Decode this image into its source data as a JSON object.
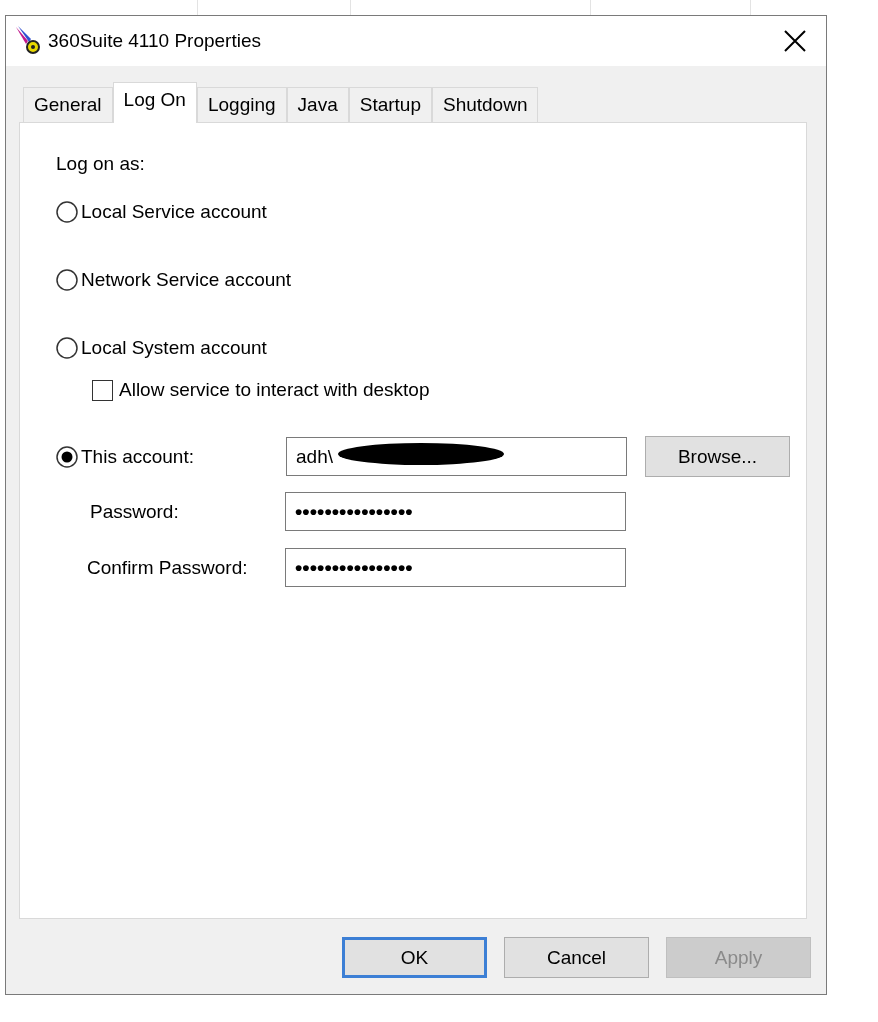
{
  "window": {
    "title": "360Suite 4110 Properties"
  },
  "tabs": [
    {
      "label": "General",
      "selected": false
    },
    {
      "label": "Log On",
      "selected": true
    },
    {
      "label": "Logging",
      "selected": false
    },
    {
      "label": "Java",
      "selected": false
    },
    {
      "label": "Startup",
      "selected": false
    },
    {
      "label": "Shutdown",
      "selected": false
    }
  ],
  "log_on_as": {
    "label": "Log on as:",
    "options": [
      {
        "label": "Local Service account",
        "selected": false
      },
      {
        "label": "Network Service account",
        "selected": false
      },
      {
        "label": "Local System account",
        "selected": false
      },
      {
        "label": "This account:",
        "selected": true
      }
    ]
  },
  "interact_checkbox": {
    "label": "Allow service to interact with desktop",
    "checked": false
  },
  "account_field": {
    "value": "adh\\",
    "redacted": true
  },
  "browse_button": {
    "label": "Browse..."
  },
  "password_fields": [
    {
      "label": "Password:",
      "value": "••••••••••••••••"
    },
    {
      "label": "Confirm Password:",
      "value": "••••••••••••••••"
    }
  ],
  "buttons": [
    {
      "label": "OK",
      "default": true,
      "disabled": false
    },
    {
      "label": "Cancel",
      "default": false,
      "disabled": false
    },
    {
      "label": "Apply",
      "default": false,
      "disabled": true
    }
  ]
}
